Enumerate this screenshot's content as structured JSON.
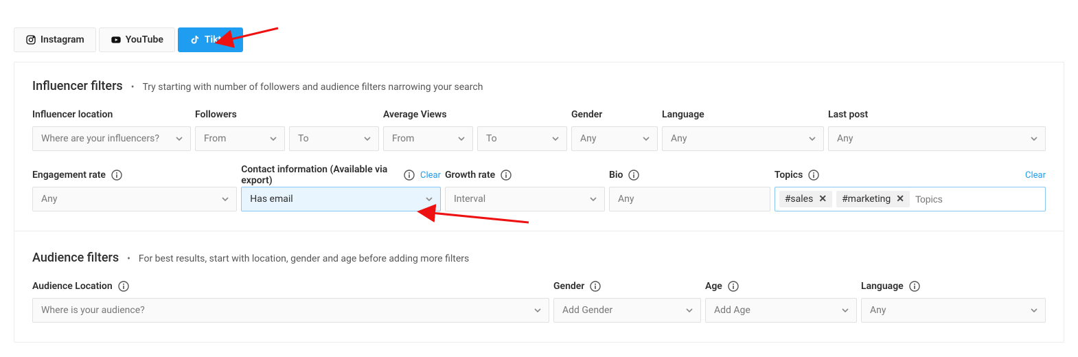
{
  "tabs": {
    "instagram": "Instagram",
    "youtube": "YouTube",
    "tiktok": "Tiktok"
  },
  "influencer": {
    "title": "Influencer filters",
    "subtitle": "Try starting with number of followers and audience filters narrowing your search",
    "location_label": "Influencer location",
    "location_placeholder": "Where are your influencers?",
    "followers_label": "Followers",
    "from": "From",
    "to": "To",
    "avgviews_label": "Average Views",
    "gender_label": "Gender",
    "language_label": "Language",
    "lastpost_label": "Last post",
    "any": "Any",
    "engagement_label": "Engagement rate",
    "contact_label": "Contact information (Available via export)",
    "contact_value": "Has email",
    "clear": "Clear",
    "growth_label": "Growth rate",
    "interval": "Interval",
    "bio_label": "Bio",
    "topics_label": "Topics",
    "topics_placeholder": "Topics",
    "topics_tokens": {
      "t0": "#sales",
      "t1": "#marketing"
    }
  },
  "audience": {
    "title": "Audience filters",
    "subtitle": "For best results, start with location, gender and age before adding more filters",
    "location_label": "Audience Location",
    "location_placeholder": "Where is your audience?",
    "gender_label": "Gender",
    "gender_placeholder": "Add Gender",
    "age_label": "Age",
    "age_placeholder": "Add Age",
    "language_label": "Language",
    "any": "Any"
  },
  "colors": {
    "accent": "#1f9df0",
    "arrow": "#e11"
  }
}
